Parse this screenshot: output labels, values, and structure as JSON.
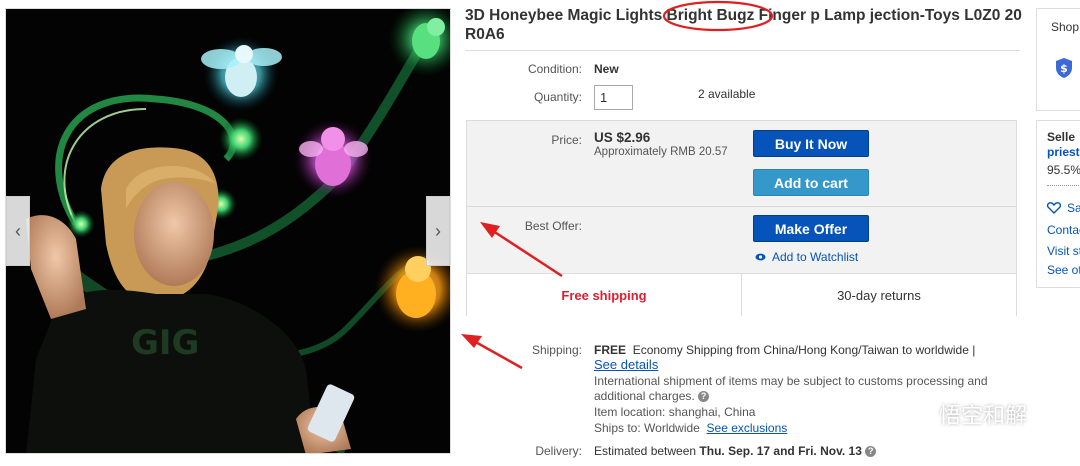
{
  "product": {
    "title": "3D Honeybee Magic Lights Bright Bugz Finger p Lamp jection-Toys L0Z0 20 R0A6"
  },
  "condition": {
    "label": "Condition:",
    "value": "New"
  },
  "quantity": {
    "label": "Quantity:",
    "value": "1",
    "available": "2 available"
  },
  "price": {
    "label": "Price:",
    "value": "US $2.96",
    "approx_prefix": "Approximately",
    "approx_value": "RMB 20.57"
  },
  "buttons": {
    "buy_now": "Buy It Now",
    "add_to_cart": "Add to cart",
    "make_offer": "Make Offer",
    "watchlist": "Add to Watchlist"
  },
  "best_offer": {
    "label": "Best Offer:"
  },
  "badges": {
    "free_shipping": "Free shipping",
    "returns": "30-day returns"
  },
  "shipping": {
    "label": "Shipping:",
    "free": "FREE",
    "method": "Economy Shipping from China/Hong Kong/Taiwan to worldwide |",
    "see_details": "See details",
    "intl_note": "International shipment of items may be subject to customs processing and additional charges.",
    "location_label": "Item location:",
    "location": "shanghai, China",
    "ships_to_label": "Ships to:",
    "ships_to": "Worldwide",
    "see_exclusions": "See exclusions"
  },
  "delivery": {
    "label": "Delivery:",
    "prefix": "Estimated between",
    "dates": "Thu. Sep. 17 and Fri. Nov. 13"
  },
  "sidebar": {
    "shop_text": "Shop",
    "seller_heading": "Selle",
    "seller_name": "priest",
    "feedback": "95.5%",
    "save": "Sa",
    "contact": "Contac",
    "visit": "Visit st",
    "see_other": "See ot"
  },
  "watermark": {
    "text": "悟空和解"
  },
  "colors": {
    "primary_button": "#0654ba",
    "secondary_button": "#3498ca",
    "free_shipping": "#dd1e31",
    "annotation": "#e02020",
    "link": "#0654ba"
  }
}
